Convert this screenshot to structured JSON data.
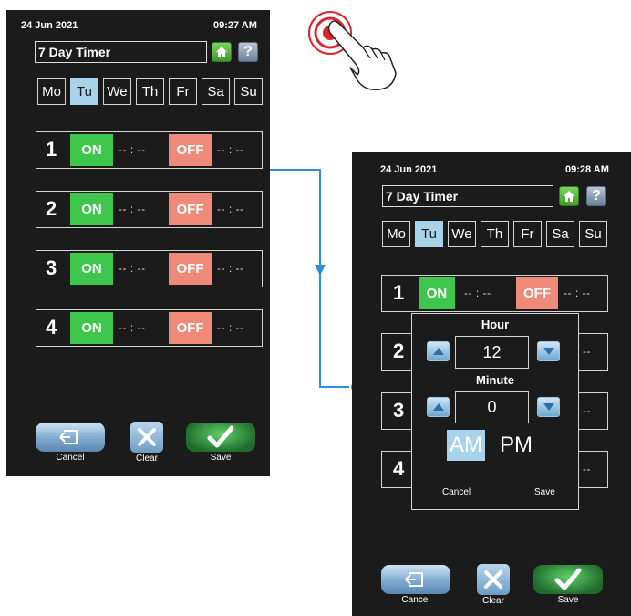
{
  "screen_before": {
    "date": "24 Jun 2021",
    "time": "09:27 AM",
    "title": "7 Day Timer",
    "days": [
      "Mo",
      "Tu",
      "We",
      "Th",
      "Fr",
      "Sa",
      "Su"
    ],
    "selected_day": "Tu",
    "rows": [
      {
        "num": "1",
        "on": "ON",
        "on_time": "-- : --",
        "off": "OFF",
        "off_time": "-- : --"
      },
      {
        "num": "2",
        "on": "ON",
        "on_time": "-- : --",
        "off": "OFF",
        "off_time": "-- : --"
      },
      {
        "num": "3",
        "on": "ON",
        "on_time": "-- : --",
        "off": "OFF",
        "off_time": "-- : --"
      },
      {
        "num": "4",
        "on": "ON",
        "on_time": "-- : --",
        "off": "OFF",
        "off_time": "-- : --"
      }
    ],
    "buttons": {
      "cancel": "Cancel",
      "clear": "Clear",
      "save": "Save"
    }
  },
  "screen_after": {
    "date": "24 Jun 2021",
    "time": "09:28 AM",
    "title": "7 Day Timer",
    "days": [
      "Mo",
      "Tu",
      "We",
      "Th",
      "Fr",
      "Sa",
      "Su"
    ],
    "selected_day": "Tu",
    "row1": {
      "num": "1",
      "on": "ON",
      "on_time": "-- : --",
      "off": "OFF",
      "off_time": "-- : --"
    },
    "row_nums": [
      "2",
      "3",
      "4"
    ],
    "row_tail": "--",
    "popup": {
      "hour_label": "Hour",
      "hour_value": "12",
      "minute_label": "Minute",
      "minute_value": "0",
      "am": "AM",
      "pm": "PM",
      "selected_period": "AM",
      "cancel": "Cancel",
      "save": "Save"
    },
    "buttons": {
      "cancel": "Cancel",
      "clear": "Clear",
      "save": "Save"
    }
  },
  "colors": {
    "screen_bg": "#1b1b1b",
    "on_green": "#3fc74d",
    "off_red": "#ef8a7b",
    "selected_day": "#a9d3ea",
    "connector_blue": "#2f8fd6",
    "tap_red": "#d9262c"
  },
  "icons": [
    "tap-hand-icon",
    "home-icon",
    "help-icon",
    "back-arrow-icon",
    "clear-x-icon",
    "checkmark-icon",
    "up-arrow-icon",
    "down-arrow-icon"
  ]
}
